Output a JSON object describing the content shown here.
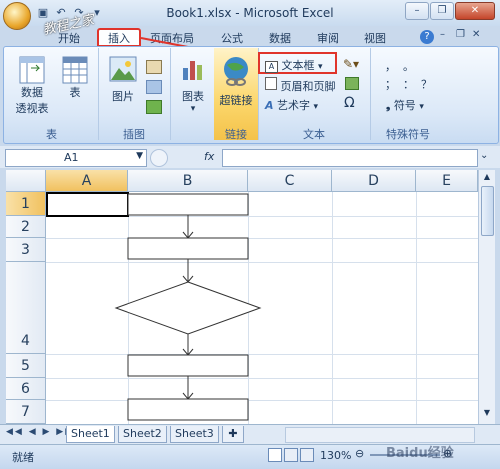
{
  "window": {
    "title": "Book1.xlsx - Microsoft Excel",
    "minimize": "–",
    "restore": "❐",
    "close": "✕",
    "help": "?"
  },
  "watermark_top": "教程之家",
  "tabs": [
    {
      "label": "开始"
    },
    {
      "label": "插入"
    },
    {
      "label": "页面布局"
    },
    {
      "label": "公式"
    },
    {
      "label": "数据"
    },
    {
      "label": "审阅"
    },
    {
      "label": "视图"
    }
  ],
  "ribbon": {
    "groups": {
      "table": {
        "label": "表",
        "pivot_line1": "数据",
        "pivot_line2": "透视表",
        "table_btn": "表"
      },
      "illustrations": {
        "label": "插图",
        "picture_btn": "图片"
      },
      "charts": {
        "label": "",
        "chart_btn": "图表"
      },
      "links": {
        "label": "链接",
        "hyperlink_btn": "超链接"
      },
      "text": {
        "label": "文本",
        "textbox_btn": "文本框",
        "header_footer_btn": "页眉和页脚",
        "wordart_btn": "艺术字"
      },
      "symbols": {
        "label": "特殊符号",
        "symbol_btn": "符号",
        "chars": [
          "，",
          "。",
          "；",
          "：",
          "？"
        ]
      }
    }
  },
  "formula_bar": {
    "name_box": "A1",
    "fx": "fx",
    "value": ""
  },
  "columns": [
    "A",
    "B",
    "C",
    "D",
    "E"
  ],
  "rows": [
    "1",
    "2",
    "3",
    "4",
    "5",
    "6",
    "7"
  ],
  "sheets": [
    {
      "label": "Sheet1"
    },
    {
      "label": "Sheet2"
    },
    {
      "label": "Sheet3"
    }
  ],
  "status": {
    "ready": "就绪",
    "zoom": "130%",
    "watermark": "Baidu经验"
  },
  "colors": {
    "accent": "#e0342b",
    "selected_header": "#f1c15f"
  }
}
